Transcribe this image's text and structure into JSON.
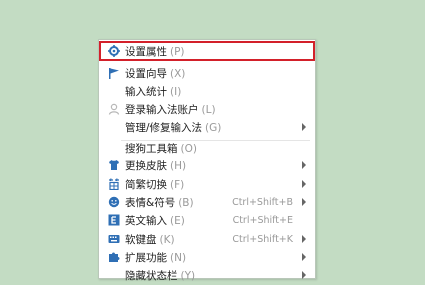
{
  "menu": {
    "items": [
      {
        "label": "设置属性",
        "key": "(P)",
        "shortcut": "",
        "submenu": false,
        "icon": "gear-icon"
      },
      {
        "label": "设置向导",
        "key": "(X)",
        "shortcut": "",
        "submenu": false,
        "icon": "flag-icon"
      },
      {
        "label": "输入统计",
        "key": "(I)",
        "shortcut": "",
        "submenu": false,
        "icon": ""
      },
      {
        "label": "登录输入法账户",
        "key": "(L)",
        "shortcut": "",
        "submenu": false,
        "icon": "user-icon"
      },
      {
        "label": "管理/修复输入法",
        "key": "(G)",
        "shortcut": "",
        "submenu": true,
        "icon": ""
      },
      {
        "label": "搜狗工具箱",
        "key": "(O)",
        "shortcut": "",
        "submenu": false,
        "icon": ""
      },
      {
        "label": "更换皮肤",
        "key": "(H)",
        "shortcut": "",
        "submenu": true,
        "icon": "shirt-icon"
      },
      {
        "label": "简繁切换",
        "key": "(F)",
        "shortcut": "",
        "submenu": true,
        "icon": "jianfan-icon"
      },
      {
        "label": "表情&符号",
        "key": "(B)",
        "shortcut": "Ctrl+Shift+B",
        "submenu": true,
        "icon": "smiley-icon"
      },
      {
        "label": "英文输入",
        "key": "(E)",
        "shortcut": "Ctrl+Shift+E",
        "submenu": false,
        "icon": "english-icon"
      },
      {
        "label": "软键盘",
        "key": "(K)",
        "shortcut": "Ctrl+Shift+K",
        "submenu": true,
        "icon": "keyboard-icon"
      },
      {
        "label": "扩展功能",
        "key": "(N)",
        "shortcut": "",
        "submenu": true,
        "icon": "puzzle-icon"
      },
      {
        "label": "隐藏状态栏",
        "key": "(Y)",
        "shortcut": "",
        "submenu": true,
        "icon": ""
      }
    ]
  }
}
